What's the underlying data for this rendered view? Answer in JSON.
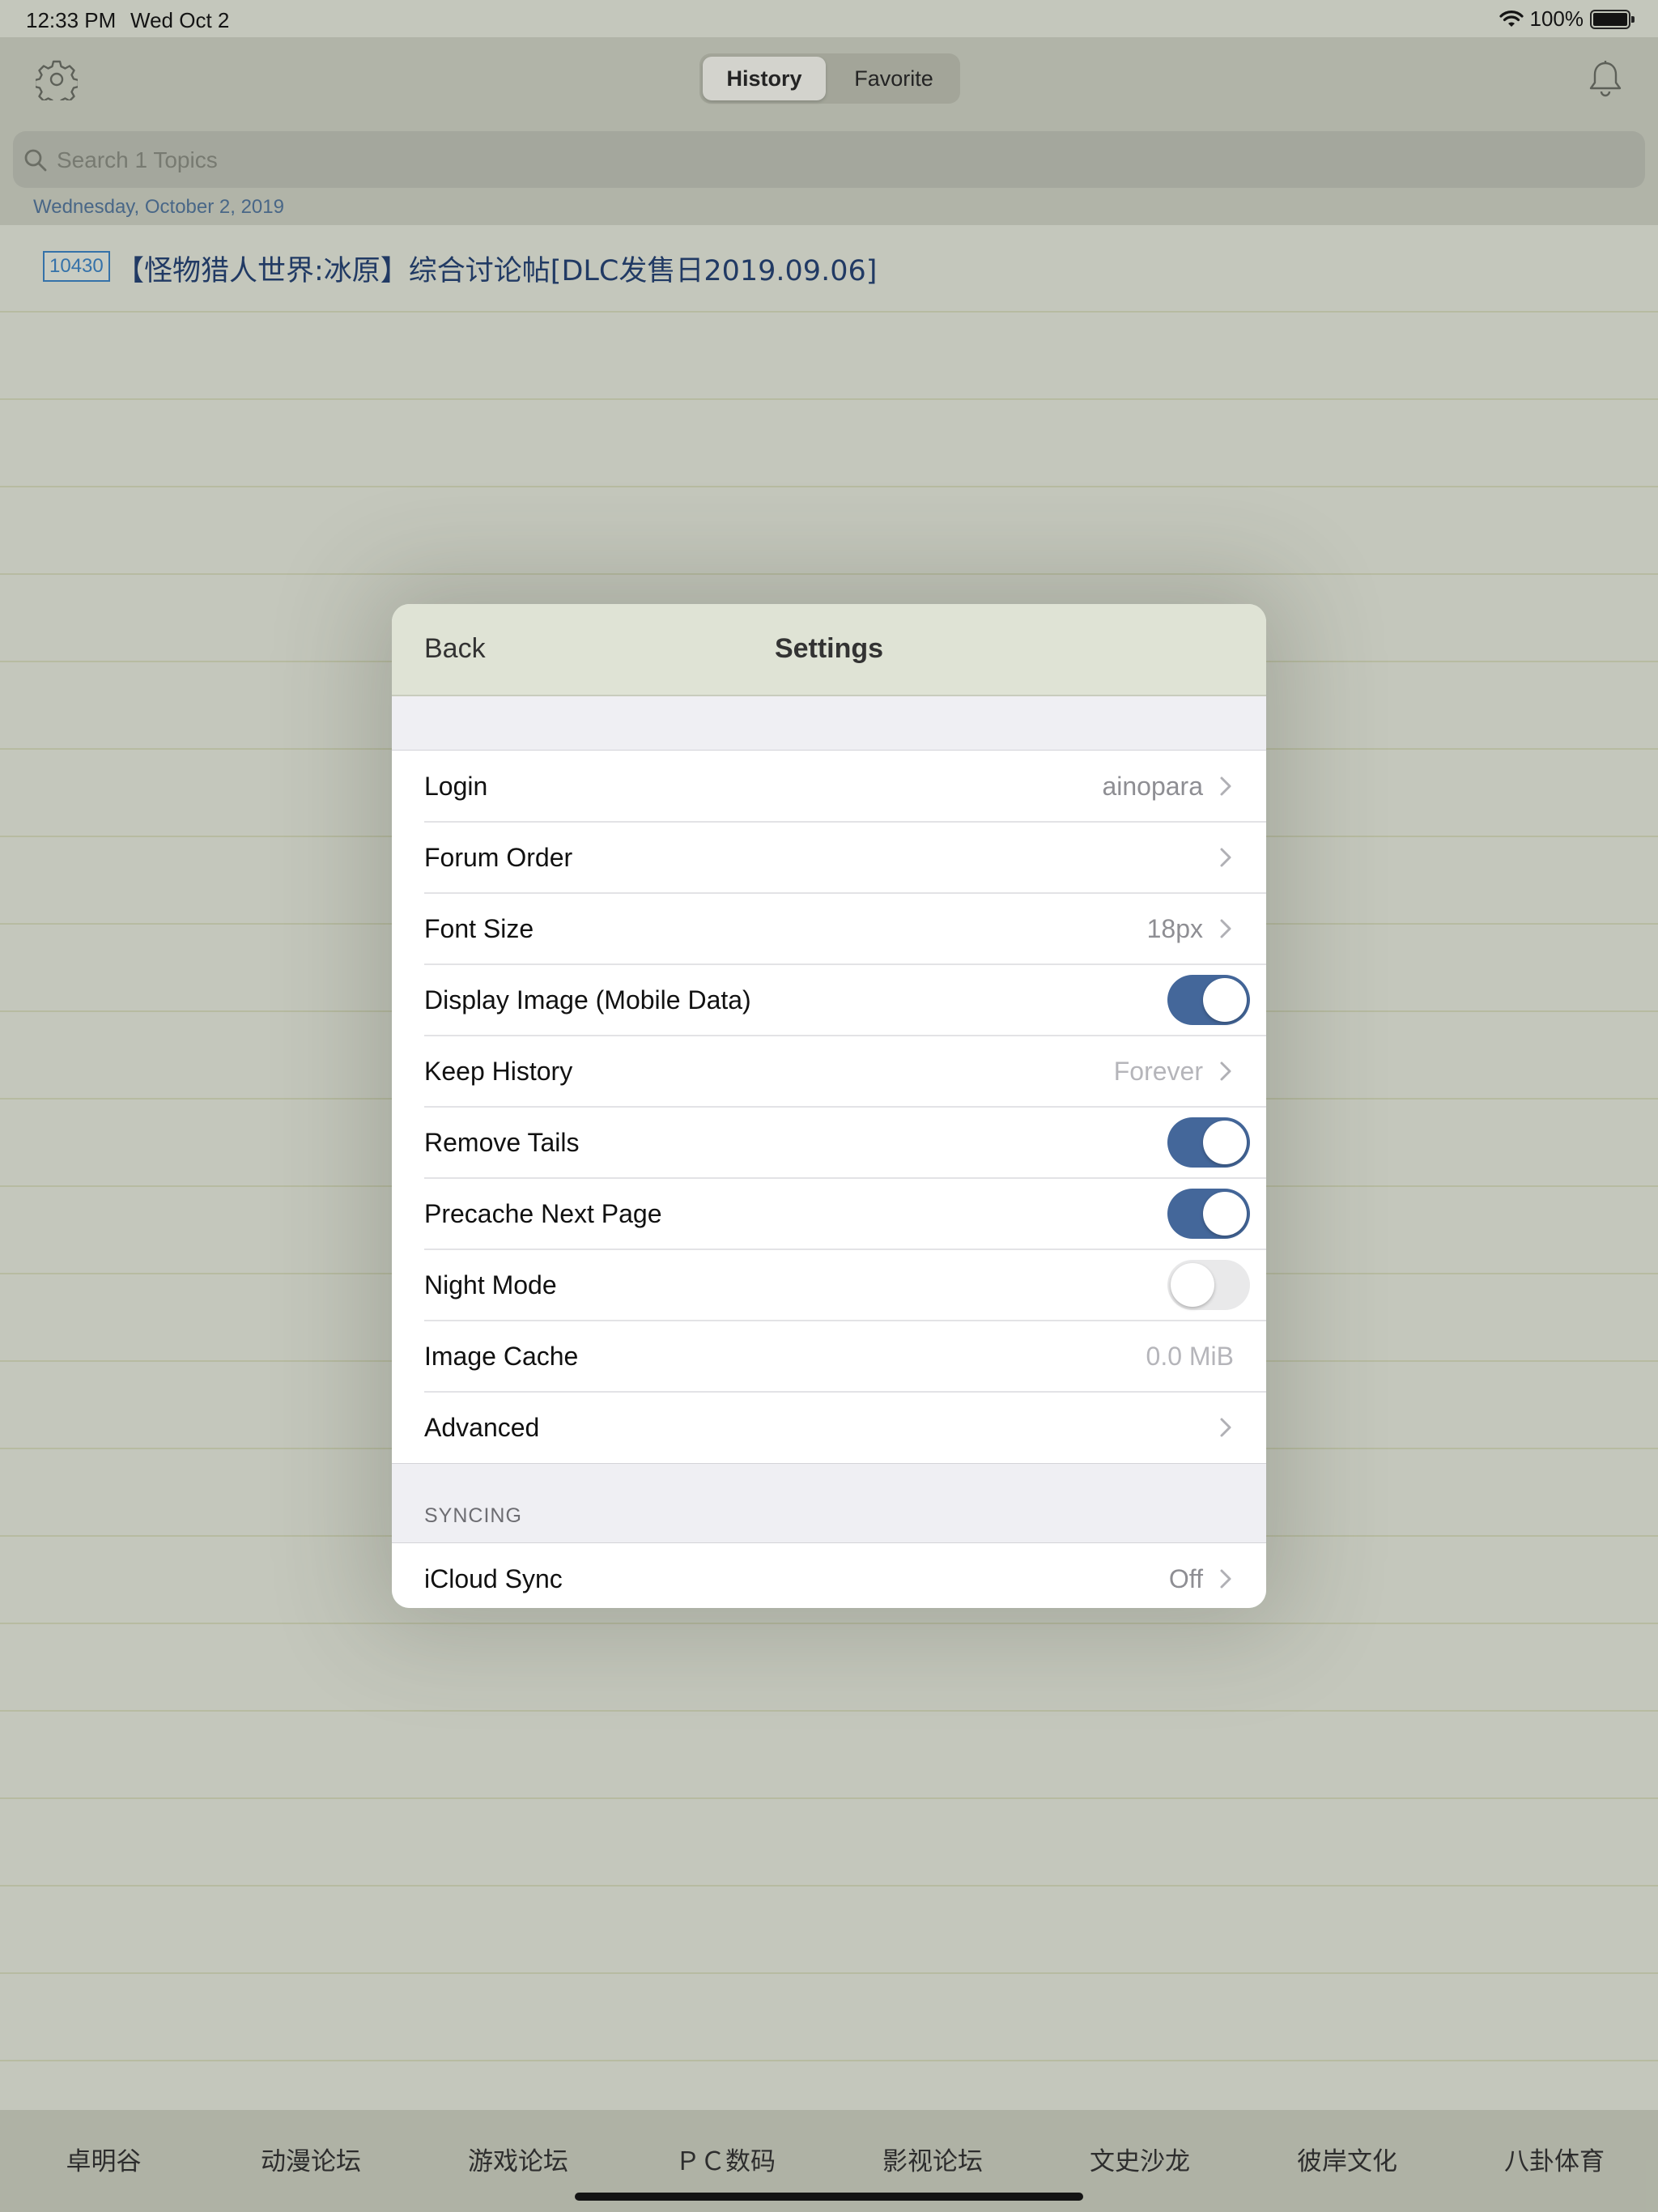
{
  "status_bar": {
    "time": "12:33 PM",
    "date": "Wed Oct 2",
    "battery": "100%"
  },
  "nav": {
    "settings_icon": "gear-icon",
    "notifications_icon": "bell-icon",
    "segments": [
      "History",
      "Favorite"
    ],
    "selected_segment": "History"
  },
  "search": {
    "placeholder": "Search 1 Topics",
    "value": ""
  },
  "list": {
    "section_header": "Wednesday, October 2, 2019",
    "topics": [
      {
        "badge": "10430",
        "title": "【怪物猎人世界:冰原】综合讨论帖[DLC发售日2019.09.06]"
      }
    ]
  },
  "tab_bar": {
    "items": [
      "卓明谷",
      "动漫论坛",
      "游戏论坛",
      "ＰＣ数码",
      "影视论坛",
      "文史沙龙",
      "彼岸文化",
      "八卦体育"
    ]
  },
  "settings": {
    "back_label": "Back",
    "title": "Settings",
    "rows": {
      "login": {
        "label": "Login",
        "value": "ainopara"
      },
      "forum_order": {
        "label": "Forum Order"
      },
      "font_size": {
        "label": "Font Size",
        "value": "18px"
      },
      "display_image": {
        "label": "Display Image (Mobile Data)",
        "on": true
      },
      "keep_history": {
        "label": "Keep History",
        "value": "Forever"
      },
      "remove_tails": {
        "label": "Remove Tails",
        "on": true
      },
      "precache": {
        "label": "Precache Next Page",
        "on": true
      },
      "night_mode": {
        "label": "Night Mode",
        "on": false
      },
      "image_cache": {
        "label": "Image Cache",
        "value": "0.0 MiB"
      },
      "advanced": {
        "label": "Advanced"
      }
    },
    "syncing_header": "SYNCING",
    "icloud_sync": {
      "label": "iCloud Sync",
      "value": "Off"
    }
  },
  "colors": {
    "accent_toggle": "#44679a",
    "topic_title": "#1f3a66",
    "badge": "#3575b0",
    "nav_background": "#b8bbaf"
  }
}
